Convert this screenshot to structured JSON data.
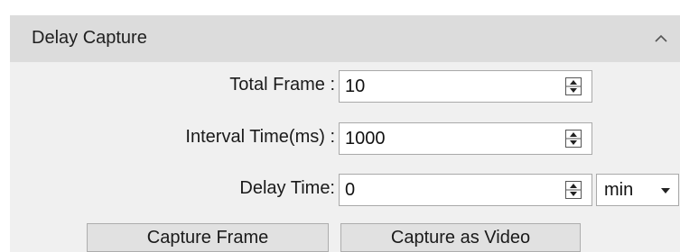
{
  "panel": {
    "title": "Delay Capture"
  },
  "fields": {
    "total_frame": {
      "label": "Total Frame :",
      "value": "10"
    },
    "interval_time": {
      "label": "Interval Time(ms) :",
      "value": "1000"
    },
    "delay_time": {
      "label": "Delay Time:",
      "value": "0",
      "unit": "min"
    }
  },
  "buttons": {
    "capture_frame": "Capture Frame",
    "capture_video": "Capture as Video"
  },
  "icons": {
    "collapse": "chevron-up-icon",
    "spinner": "spin-up-down-icon",
    "dropdown": "caret-down-icon"
  }
}
